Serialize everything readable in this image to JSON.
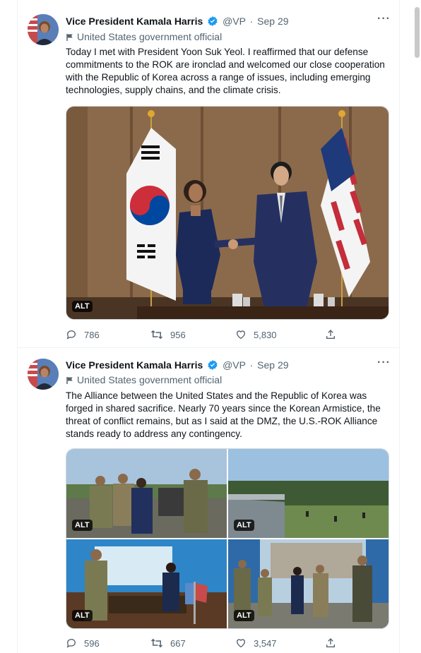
{
  "tweets": [
    {
      "author": "Vice President Kamala Harris",
      "handle": "@VP",
      "sep": "·",
      "date": "Sep 29",
      "more": "···",
      "label": "United States government official",
      "text": "Today I met with President Yoon Suk Yeol. I reaffirmed that our defense commitments to the ROK are ironclad and welcomed our close cooperation with the Republic of Korea across a range of issues, including emerging technologies, supply chains, and the climate crisis.",
      "media_alt": [
        "ALT"
      ],
      "replies": "786",
      "retweets": "956",
      "likes": "5,830"
    },
    {
      "author": "Vice President Kamala Harris",
      "handle": "@VP",
      "sep": "·",
      "date": "Sep 29",
      "more": "···",
      "label": "United States government official",
      "text": "The Alliance between the United States and the Republic of Korea was forged in shared sacrifice. Nearly 70 years since the Korean Armistice, the threat of conflict remains, but as I said at the DMZ, the U.S.-ROK Alliance stands ready to address any contingency.",
      "media_alt": [
        "ALT",
        "ALT",
        "ALT",
        "ALT"
      ],
      "replies": "596",
      "retweets": "667",
      "likes": "3,547"
    }
  ],
  "icons": {
    "verified": "verified-badge-icon",
    "government": "flag-icon",
    "reply": "reply-icon",
    "retweet": "retweet-icon",
    "like": "heart-icon",
    "share": "share-icon"
  },
  "colors": {
    "accent": "#1d9bf0",
    "secondary_text": "#536471",
    "primary_text": "#0f1419"
  }
}
